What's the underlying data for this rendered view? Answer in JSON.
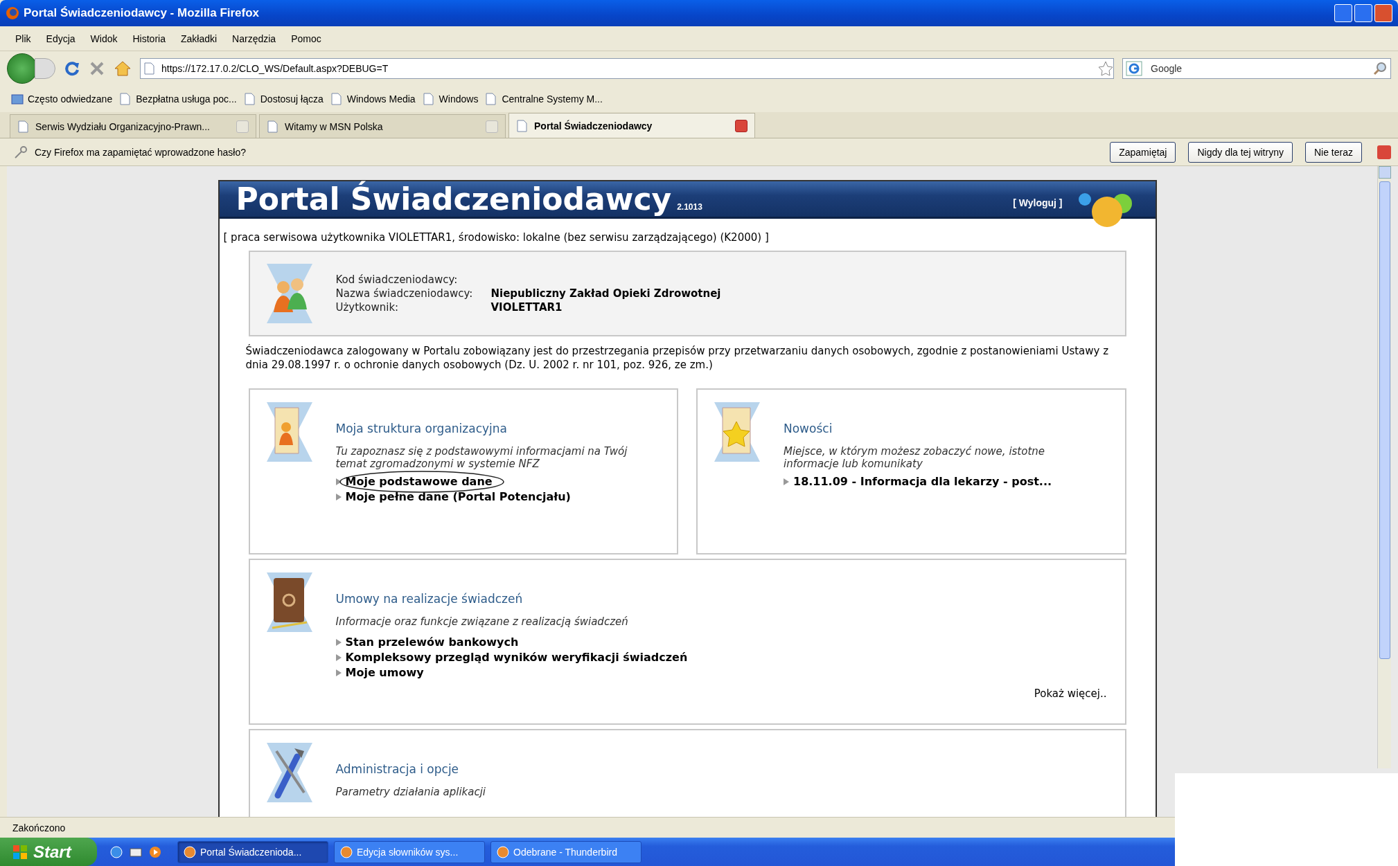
{
  "window": {
    "title": "Portal Świadczeniodawcy - Mozilla Firefox"
  },
  "menu": [
    "Plik",
    "Edycja",
    "Widok",
    "Historia",
    "Zakładki",
    "Narzędzia",
    "Pomoc"
  ],
  "navigation": {
    "url": "https://172.17.0.2/CLO_WS/Default.aspx?DEBUG=T",
    "search_placeholder": "Google"
  },
  "bookmarks": [
    "Często odwiedzane",
    "Bezpłatna usługa poc...",
    "Dostosuj łącza",
    "Windows Media",
    "Windows",
    "Centralne Systemy M..."
  ],
  "tabs": [
    {
      "label": "Serwis Wydziału Organizacyjno-Prawn...",
      "selected": false
    },
    {
      "label": "Witamy w MSN Polska",
      "selected": false
    },
    {
      "label": "Portal Świadczeniodawcy",
      "selected": true
    }
  ],
  "notification": {
    "text": "Czy Firefox ma zapamiętać wprowadzone hasło?",
    "buttons": [
      "Zapamiętaj",
      "Nigdy dla tej witryny",
      "Nie teraz"
    ]
  },
  "portal": {
    "title": "Portal Świadczeniodawcy",
    "version": "2.1013",
    "logout": "[ Wyloguj ]",
    "session_info": "[ praca serwisowa użytkownika VIOLETTAR1, środowisko: lokalne (bez serwisu zarządzającego) (K2000) ]",
    "provider_fields": [
      {
        "label": "Kod świadczeniodawcy:"
      },
      {
        "label": "Nazwa świadczeniodawcy:",
        "value": "Niepubliczny Zakład Opieki Zdrowotnej"
      },
      {
        "label": "Użytkownik:",
        "value": "VIOLETTAR1"
      }
    ],
    "notice": "Świadczeniodawca zalogowany w Portalu zobowiązany jest do przestrzegania przepisów przy przetwarzaniu danych osobowych, zgodnie z postanowieniami Ustawy z dnia 29.08.1997 r. o ochronie danych osobowych (Dz. U. 2002 r. nr 101, poz. 926, ze zm.)",
    "sections": [
      {
        "kind": "half",
        "title": "Moja struktura organizacyjna",
        "description": "Tu zapoznasz się z podstawowymi informacjami na Twój temat zgromadzonymi w systemie NFZ",
        "links": [
          "Moje podstawowe dane",
          "Moje pełne dane (Portal Potencjału)"
        ]
      },
      {
        "kind": "half",
        "title": "Nowości",
        "description": "Miejsce, w którym możesz zobaczyć nowe, istotne informacje lub komunikaty",
        "links": [
          "18.11.09 - Informacja dla lekarzy - post..."
        ]
      },
      {
        "kind": "full",
        "title": "Umowy na realizacje świadczeń",
        "description": "Informacje oraz funkcje związane z realizacją świadczeń",
        "links": [
          "Stan przelewów bankowych",
          "Kompleksowy przegląd wyników weryfikacji świadczeń",
          "Moje umowy"
        ],
        "more": "Pokaż więcej.."
      },
      {
        "kind": "full",
        "title": "Administracja i opcje",
        "description": "Parametry działania aplikacji"
      }
    ]
  },
  "status_bar": "Zakończono",
  "taskbar": {
    "start": "Start",
    "tasks": [
      {
        "label": "Portal Świadczenioda...",
        "selected": true
      },
      {
        "label": "Edycja słowników sys...",
        "selected": false
      },
      {
        "label": "Odebrane - Thunderbird",
        "selected": false
      }
    ]
  }
}
